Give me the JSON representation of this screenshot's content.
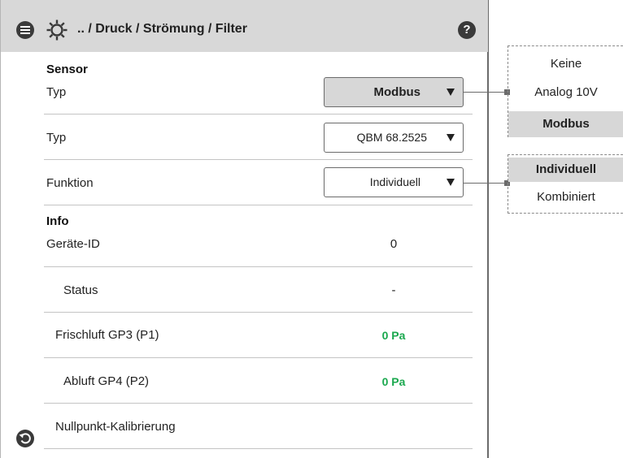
{
  "header": {
    "breadcrumb": ".. / Druck / Strömung / Filter",
    "help_label": "?"
  },
  "sensor": {
    "section_title": "Sensor",
    "typ1": {
      "label": "Typ",
      "value": "Modbus"
    },
    "typ2": {
      "label": "Typ",
      "value": "QBM 68.2525"
    },
    "funktion": {
      "label": "Funktion",
      "value": "Individuell"
    }
  },
  "info": {
    "section_title": "Info",
    "rows": [
      {
        "label": "Geräte-ID",
        "value": "0"
      },
      {
        "label": "Status",
        "value": "-"
      },
      {
        "label": "Frischluft GP3 (P1)",
        "value": "0 Pa"
      },
      {
        "label": "Abluft GP4 (P2)",
        "value": "0 Pa"
      },
      {
        "label": "Nullpunkt-Kalibrierung",
        "value": ""
      }
    ]
  },
  "typ_options": [
    "Keine",
    "Analog 10V",
    "Modbus"
  ],
  "typ_selected": "Modbus",
  "funktion_options": [
    "Individuell",
    "Kombiniert"
  ],
  "funktion_selected": "Individuell",
  "colors": {
    "header_bg": "#d8d8d8",
    "value_green": "#1aa84e",
    "selected_bg": "#d7d7d7"
  },
  "icons": [
    "menu-icon",
    "gear-icon",
    "help-icon",
    "back-icon",
    "dropdown-arrow-icon"
  ]
}
